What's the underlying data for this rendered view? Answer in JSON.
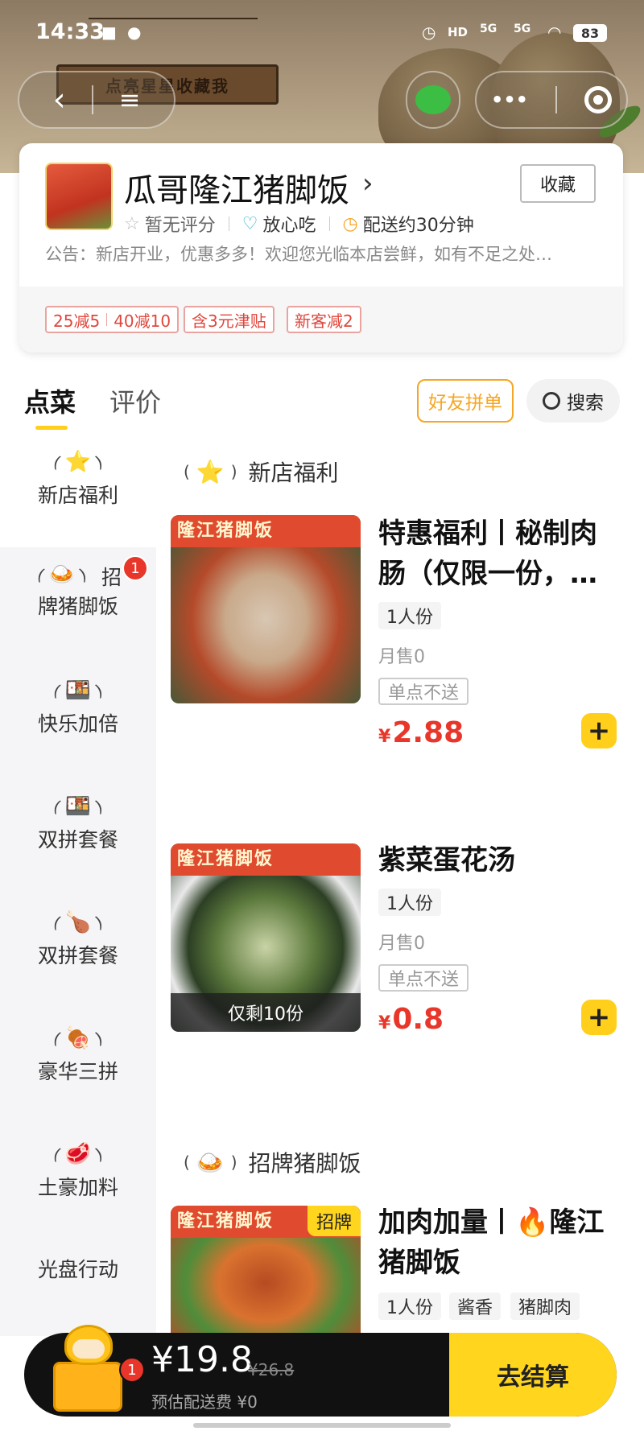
{
  "status": {
    "time": "14:33",
    "battery": "83",
    "net1": "5G",
    "net2": "5G",
    "hd": "HD"
  },
  "banner": {
    "sign_text": "点亮星星收藏我"
  },
  "nav": {
    "back_icon": "back-icon",
    "menu_icon": "menu-icon",
    "more_label": "•••"
  },
  "store": {
    "name": "瓜哥隆江猪脚饭",
    "chevron": "›",
    "favorite_label": "收藏",
    "rating_text": "暂无评分",
    "safe_text": "放心吃",
    "delivery_text": "配送约30分钟",
    "notice": "公告：新店开业，优惠多多！欢迎您光临本店尝鲜，如有不足之处…",
    "promos": [
      {
        "a": "25减5",
        "b": "40减10"
      },
      {
        "a": "含3元津贴"
      },
      {
        "a": "新客减2"
      }
    ]
  },
  "tabs": {
    "order": "点菜",
    "review": "评价",
    "group_order": "好友拼单",
    "search": "搜索"
  },
  "categories": [
    {
      "icon": "⭐",
      "label": "新店福利"
    },
    {
      "icon": "🍛",
      "label_a": "招",
      "label_b": "牌猪脚饭",
      "badge": "1"
    },
    {
      "icon": "🍱",
      "label": "快乐加倍"
    },
    {
      "icon": "🍱",
      "label": "双拼套餐"
    },
    {
      "icon": "🍗",
      "label": "双拼套餐"
    },
    {
      "icon": "🍖",
      "label": "豪华三拼"
    },
    {
      "icon": "🥩",
      "label": "土豪加料"
    },
    {
      "label": "光盘行动"
    }
  ],
  "sections": [
    {
      "icon": "⭐",
      "title": "新店福利"
    },
    {
      "icon": "🍛",
      "title": "招牌猪脚饭"
    }
  ],
  "items": [
    {
      "img_text": "隆江猪脚饭",
      "name": "特惠福利丨秘制肉肠（仅限一份，…",
      "tags": [
        "1人份"
      ],
      "sales": "月售0",
      "nodeliver": "单点不送",
      "currency": "¥",
      "price": "2.88",
      "add": "+"
    },
    {
      "img_text": "隆江猪脚饭",
      "remain": "仅剩10份",
      "name": "紫菜蛋花汤",
      "tags": [
        "1人份"
      ],
      "sales": "月售0",
      "nodeliver": "单点不送",
      "currency": "¥",
      "price": "0.8",
      "add": "+"
    },
    {
      "img_text": "隆江猪脚饭",
      "sig": "招牌",
      "name": "加肉加量丨🔥隆江猪脚饭",
      "tags": [
        "1人份",
        "酱香",
        "猪脚肉"
      ]
    }
  ],
  "cart": {
    "badge": "1",
    "price": "¥19.8",
    "old_price": "¥26.8",
    "fee": "预估配送费 ¥0",
    "checkout": "去结算"
  },
  "colors": {
    "accent": "#ffcf1c",
    "price_red": "#e8362a",
    "group_orange": "#f5a623"
  }
}
